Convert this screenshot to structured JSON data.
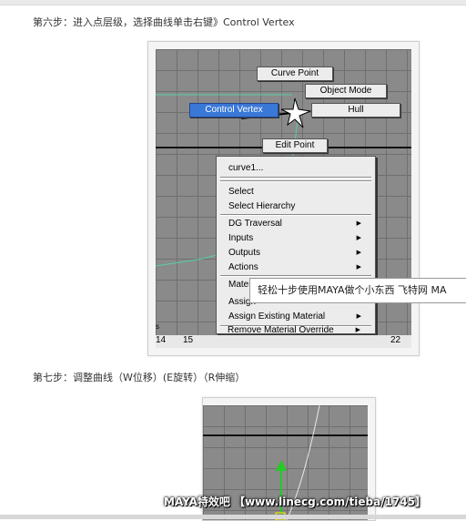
{
  "step6": {
    "text": "第六步：进入点层级，选择曲线单击右键》Control Vertex"
  },
  "marking_menu": {
    "curve_point": "Curve Point",
    "object_mode": "Object Mode",
    "control_vertex": "Control Vertex",
    "hull": "Hull",
    "edit_point": "Edit Point"
  },
  "context_menu": {
    "items": [
      {
        "label": "curve1...",
        "submenu": false
      },
      {
        "label": "Select",
        "submenu": false
      },
      {
        "label": "Select Hierarchy",
        "submenu": false
      },
      {
        "label": "DG Traversal",
        "submenu": true
      },
      {
        "label": "Inputs",
        "submenu": true
      },
      {
        "label": "Outputs",
        "submenu": true
      },
      {
        "label": "Actions",
        "submenu": true
      },
      {
        "label": "Materi",
        "submenu": false
      },
      {
        "label": "Assign",
        "submenu": false
      },
      {
        "label": "Assign Existing Material",
        "submenu": true
      },
      {
        "label": "Remove Material Override",
        "submenu": true
      }
    ]
  },
  "tooltip": {
    "text": "轻松十步使用MAYA做个小东西 飞特网 MA"
  },
  "ruler": {
    "labels": [
      "14",
      "15",
      "22"
    ]
  },
  "side_mark": "s",
  "step7": {
    "text": "第七步：调整曲线（W位移）(E旋转）（R伸缩）"
  },
  "watermark": {
    "text": "MAYA特效吧 【www.linecg.com/tieba/1745】"
  },
  "colors": {
    "viewport": "#8a8a8a",
    "grid": "#6f6f6f",
    "selected": "#3a78d8",
    "curve": "#58d0a0",
    "y_axis": "#22cc22",
    "x_axis": "#dd2222"
  },
  "arrow_glyph": "▶"
}
